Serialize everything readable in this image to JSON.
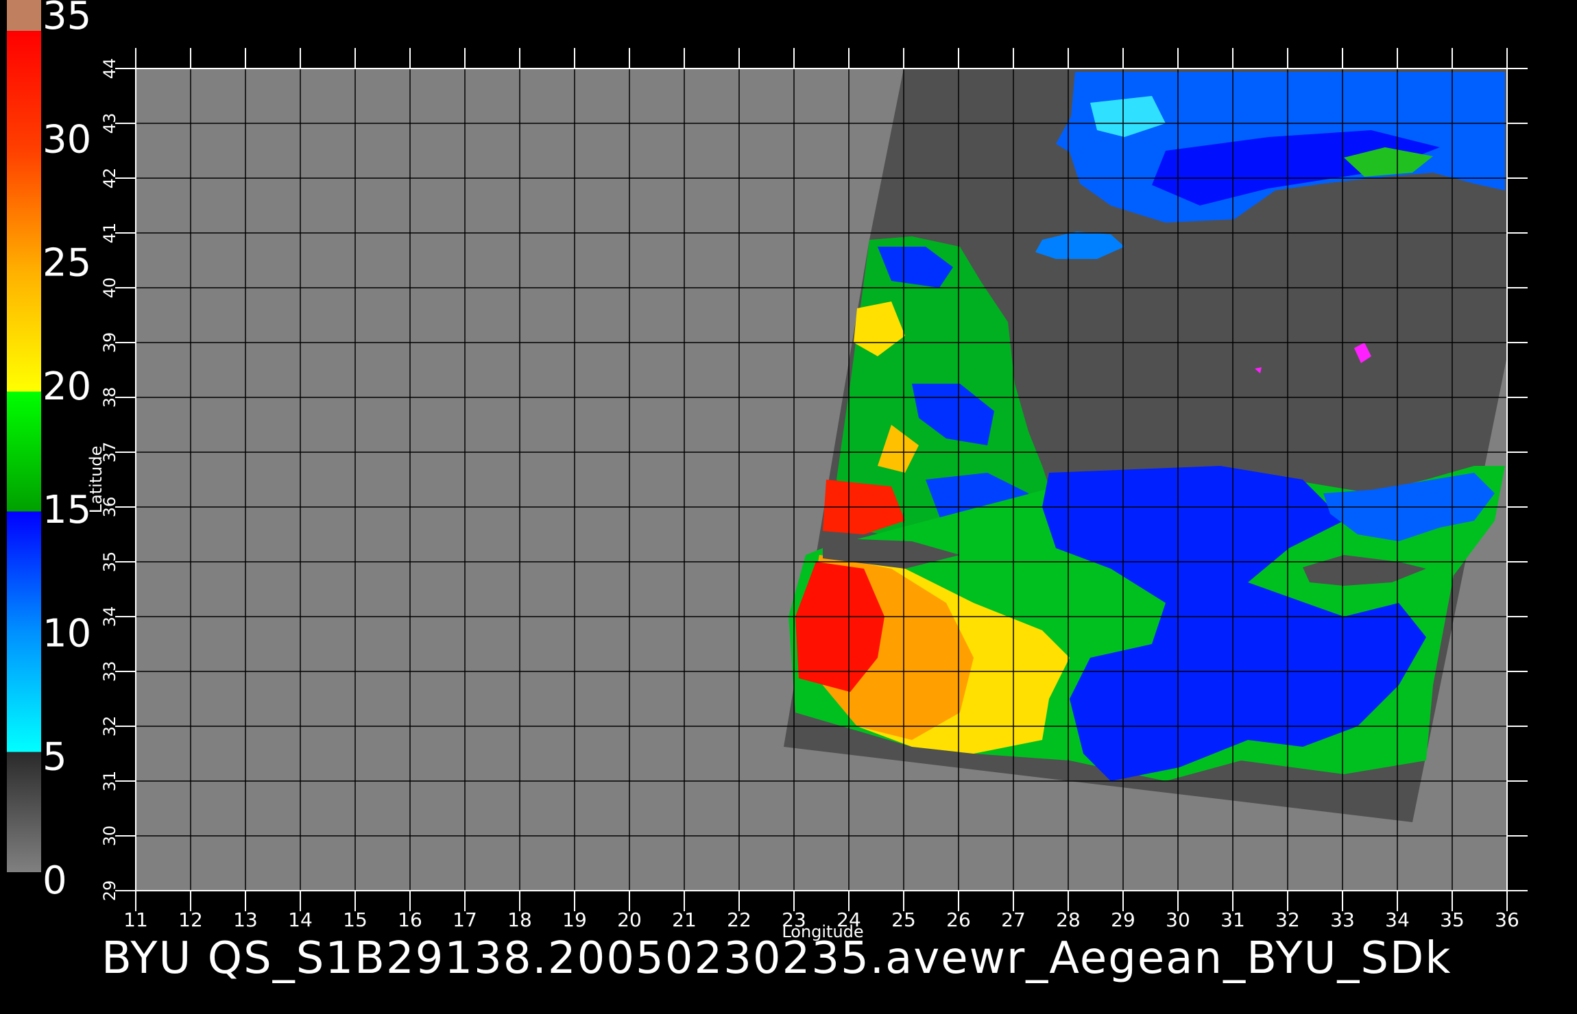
{
  "colorbar": {
    "labels": [
      "35",
      "30",
      "25",
      "20",
      "15",
      "10",
      "5",
      "0"
    ],
    "stops": [
      {
        "value": 0,
        "color": "#808080"
      },
      {
        "value": 5,
        "color": "#2a2a2a"
      },
      {
        "value": 5,
        "color": "#00ffff"
      },
      {
        "value": 10,
        "color": "#0090ff"
      },
      {
        "value": 15,
        "color": "#0000ff"
      },
      {
        "value": 15,
        "color": "#00a000"
      },
      {
        "value": 20,
        "color": "#00ff00"
      },
      {
        "value": 20,
        "color": "#ffff00"
      },
      {
        "value": 25,
        "color": "#ffb000"
      },
      {
        "value": 30,
        "color": "#ff4000"
      },
      {
        "value": 35,
        "color": "#ff0000"
      }
    ],
    "top_color": "#c08060"
  },
  "axes": {
    "xlabel": "Longitude",
    "ylabel": "Latitude",
    "x_ticks": [
      "11",
      "12",
      "13",
      "14",
      "15",
      "16",
      "17",
      "18",
      "19",
      "20",
      "21",
      "22",
      "23",
      "24",
      "25",
      "26",
      "27",
      "28",
      "29",
      "30",
      "31",
      "32",
      "33",
      "34",
      "35",
      "36"
    ],
    "y_ticks": [
      "29",
      "30",
      "31",
      "32",
      "33",
      "34",
      "35",
      "36",
      "37",
      "38",
      "39",
      "40",
      "41",
      "42",
      "43",
      "44"
    ]
  },
  "map_colors": {
    "land": "#808080",
    "swath": "#505050",
    "grid": "#000000"
  },
  "caption": "BYU  QS_S1B29138.20050230235.avewr_Aegean_BYU_SDk"
}
